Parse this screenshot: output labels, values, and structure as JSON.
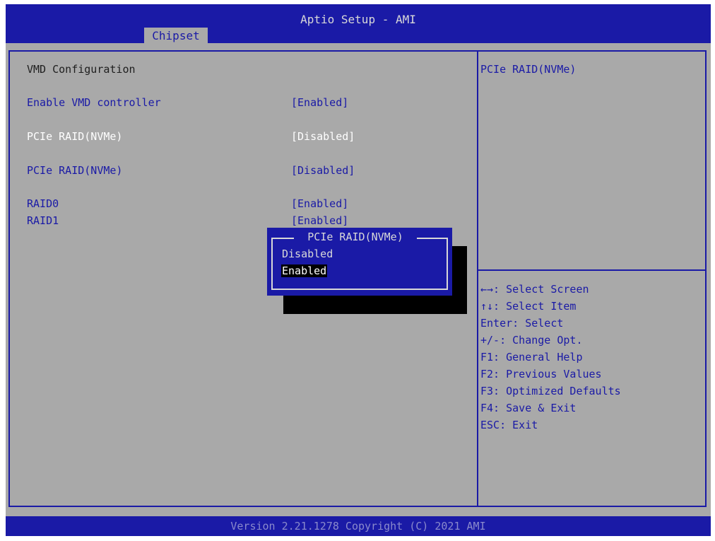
{
  "header": {
    "title": "Aptio Setup - AMI",
    "tab": "Chipset"
  },
  "settings": {
    "section_title": "VMD Configuration",
    "items": [
      {
        "label": "Enable VMD controller",
        "value": "[Enabled]"
      },
      {
        "label": "PCIe RAID(NVMe)",
        "value": "[Disabled]"
      },
      {
        "label": "PCIe RAID(NVMe)",
        "value": "[Disabled]"
      },
      {
        "label": "RAID0",
        "value": "[Enabled]"
      },
      {
        "label": "RAID1",
        "value": "[Enabled]"
      }
    ]
  },
  "help": {
    "title": "PCIe RAID(NVMe)",
    "keys": [
      {
        "key": "←→:",
        "desc": "Select Screen"
      },
      {
        "key": "↑↓:",
        "desc": "Select Item"
      },
      {
        "key": "Enter:",
        "desc": "Select"
      },
      {
        "key": "+/-:",
        "desc": "Change Opt."
      },
      {
        "key": "F1:",
        "desc": "General Help"
      },
      {
        "key": "F2:",
        "desc": "Previous Values"
      },
      {
        "key": "F3:",
        "desc": "Optimized Defaults"
      },
      {
        "key": "F4:",
        "desc": "Save & Exit"
      },
      {
        "key": "ESC:",
        "desc": "Exit"
      }
    ]
  },
  "popup": {
    "title": "PCIe RAID(NVMe)",
    "options": [
      "Disabled",
      "Enabled"
    ],
    "selected": "Enabled"
  },
  "footer": {
    "version": "Version 2.21.1278 Copyright (C) 2021 AMI"
  },
  "colors": {
    "bios_blue": "#1a1aa6",
    "panel_gray": "#a9a9a9",
    "highlight_white": "#ffffff"
  }
}
